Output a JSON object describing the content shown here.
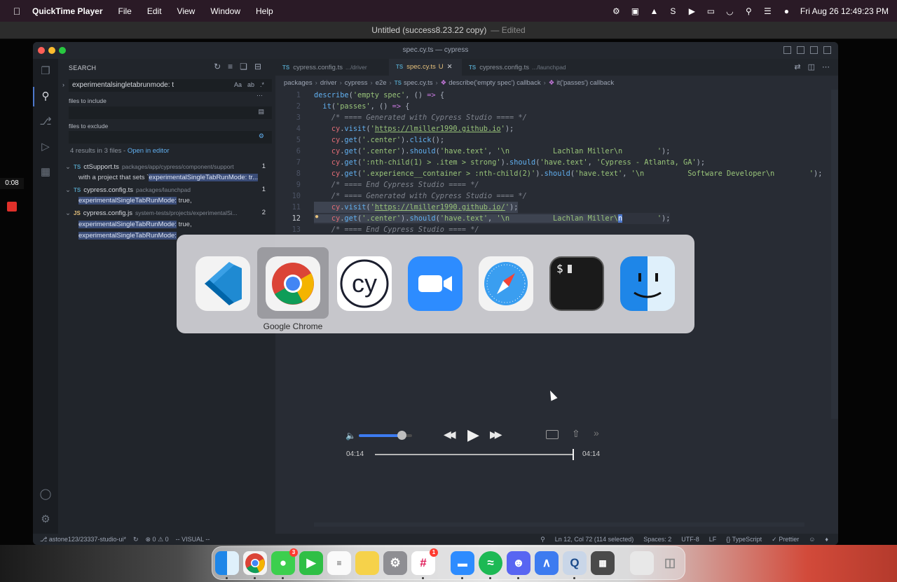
{
  "menubar": {
    "app": "QuickTime Player",
    "menus": [
      "File",
      "Edit",
      "View",
      "Window",
      "Help"
    ],
    "datetime": "Fri Aug 26  12:49:23 PM",
    "status_icons": [
      "gear-icon",
      "camera-icon",
      "arch-icon",
      "s-icon",
      "play-icon",
      "battery-icon",
      "wifi-icon",
      "search-icon",
      "control-center-icon",
      "siri-icon"
    ]
  },
  "qt_window": {
    "title": "Untitled (success8.23.22 copy)",
    "subtitle": "— Edited"
  },
  "recording": {
    "time": "0:08"
  },
  "vscode": {
    "title": "spec.cy.ts — cypress",
    "sidebar": {
      "header": "SEARCH",
      "search_value": "experimentalsingletabrunmode: t",
      "opts": [
        "Aa",
        "ab",
        ".*"
      ],
      "files_include_label": "files to include",
      "files_exclude_label": "files to exclude",
      "results_text": "4 results in 3 files - ",
      "open_in_editor": "Open in editor",
      "files": [
        {
          "icon": "TS",
          "name": "ctSupport.ts",
          "path": "packages/app/cypress/component/support",
          "count": "1",
          "matches": [
            {
              "pre": "with a project that sets `",
              "hit": "experimentalSingleTabRunMode: tr..."
            }
          ]
        },
        {
          "icon": "TS",
          "name": "cypress.config.ts",
          "path": "packages/launchpad",
          "count": "1",
          "matches": [
            {
              "pre": "",
              "hit": "experimentalSingleTabRunMode:",
              "post": " true,"
            }
          ]
        },
        {
          "icon": "JS",
          "name": "cypress.config.js",
          "path": "system-tests/projects/experimentalSi...",
          "count": "2",
          "matches": [
            {
              "pre": "",
              "hit": "experimentalSingleTabRunMode:",
              "post": " true,"
            },
            {
              "pre": "",
              "hit": "experimentalSingleTabRunMode:",
              "post": ""
            }
          ]
        }
      ]
    },
    "tabs": [
      {
        "icon": "TS",
        "name": "cypress.config.ts",
        "dim": ".../driver"
      },
      {
        "icon": "TS",
        "name": "spec.cy.ts",
        "dim": "",
        "mod": "U",
        "close": "✕"
      },
      {
        "icon": "TS",
        "name": "cypress.config.ts",
        "dim": ".../launchpad"
      }
    ],
    "breadcrumbs": [
      "packages",
      "driver",
      "cypress",
      "e2e",
      "spec.cy.ts",
      "describe('empty spec') callback",
      "it('passes') callback"
    ],
    "line_numbers": [
      "1",
      "2",
      "3",
      "4",
      "5",
      "6",
      "7",
      "8",
      "9",
      "10",
      "11",
      "12",
      "13"
    ],
    "status": {
      "branch": "astone123/23337-studio-ui*",
      "problems": "⊗ 0 ⚠ 0",
      "mode": "-- VISUAL --",
      "position": "Ln 12, Col 72 (114 selected)",
      "spaces": "Spaces: 2",
      "encoding": "UTF-8",
      "eol": "LF",
      "language": "TypeScript",
      "formatter": "Prettier"
    }
  },
  "app_switcher": {
    "apps": [
      "vscode-icon",
      "chrome-icon",
      "cypress-icon",
      "zoom-icon",
      "safari-icon",
      "terminal-icon",
      "finder-icon"
    ],
    "selected_label": "Google Chrome",
    "cypress_text": "cy",
    "terminal_text": "$"
  },
  "player": {
    "time_current": "04:14",
    "time_total": "04:14",
    "volume": 0.8,
    "progress": 1.0
  },
  "dock": {
    "icons": [
      "finder-icon",
      "chrome-icon",
      "messages-icon",
      "facetime-icon",
      "reminders-icon",
      "notes-icon",
      "settings-icon",
      "slack-icon",
      "zoom-icon",
      "spotify-icon",
      "discord-icon",
      "arc-icon",
      "quicktime-icon",
      "calculator-icon",
      "preview-icon",
      "trash-icon"
    ],
    "badges": {
      "messages": "3",
      "slack": "1"
    }
  }
}
